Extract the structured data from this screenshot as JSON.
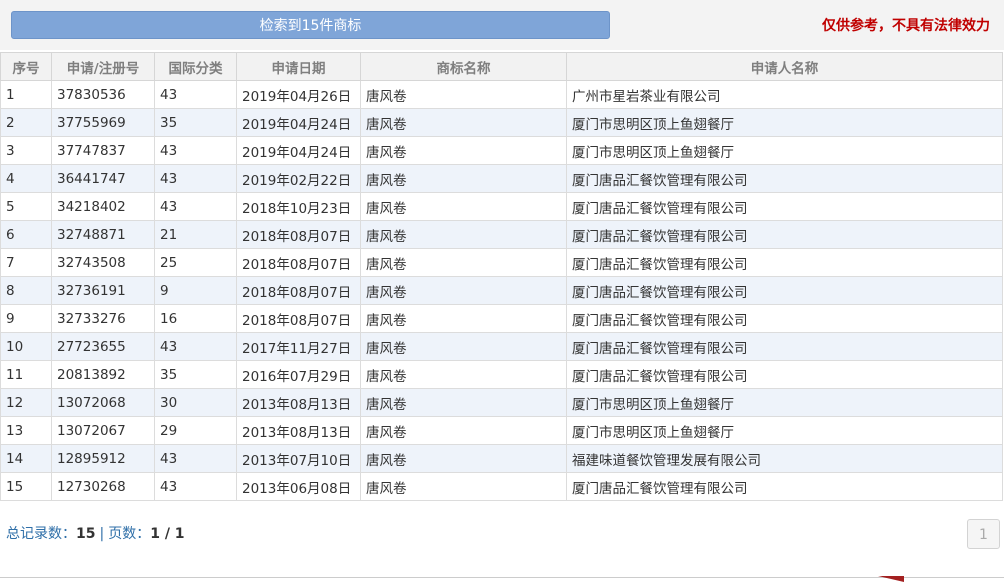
{
  "header": {
    "result_text": "检索到15件商标",
    "disclaimer": "仅供参考，不具有法律效力"
  },
  "table": {
    "columns": [
      "序号",
      "申请/注册号",
      "国际分类",
      "申请日期",
      "商标名称",
      "申请人名称"
    ],
    "rows": [
      [
        "1",
        "37830536",
        "43",
        "2019年04月26日",
        "唐风卷",
        "广州市星岩茶业有限公司"
      ],
      [
        "2",
        "37755969",
        "35",
        "2019年04月24日",
        "唐风卷",
        "厦门市思明区顶上鱼翅餐厅"
      ],
      [
        "3",
        "37747837",
        "43",
        "2019年04月24日",
        "唐风卷",
        "厦门市思明区顶上鱼翅餐厅"
      ],
      [
        "4",
        "36441747",
        "43",
        "2019年02月22日",
        "唐风卷",
        "厦门唐品汇餐饮管理有限公司"
      ],
      [
        "5",
        "34218402",
        "43",
        "2018年10月23日",
        "唐风卷",
        "厦门唐品汇餐饮管理有限公司"
      ],
      [
        "6",
        "32748871",
        "21",
        "2018年08月07日",
        "唐风卷",
        "厦门唐品汇餐饮管理有限公司"
      ],
      [
        "7",
        "32743508",
        "25",
        "2018年08月07日",
        "唐风卷",
        "厦门唐品汇餐饮管理有限公司"
      ],
      [
        "8",
        "32736191",
        "9",
        "2018年08月07日",
        "唐风卷",
        "厦门唐品汇餐饮管理有限公司"
      ],
      [
        "9",
        "32733276",
        "16",
        "2018年08月07日",
        "唐风卷",
        "厦门唐品汇餐饮管理有限公司"
      ],
      [
        "10",
        "27723655",
        "43",
        "2017年11月27日",
        "唐风卷",
        "厦门唐品汇餐饮管理有限公司"
      ],
      [
        "11",
        "20813892",
        "35",
        "2016年07月29日",
        "唐风卷",
        "厦门唐品汇餐饮管理有限公司"
      ],
      [
        "12",
        "13072068",
        "30",
        "2013年08月13日",
        "唐风卷",
        "厦门市思明区顶上鱼翅餐厅"
      ],
      [
        "13",
        "13072067",
        "29",
        "2013年08月13日",
        "唐风卷",
        "厦门市思明区顶上鱼翅餐厅"
      ],
      [
        "14",
        "12895912",
        "43",
        "2013年07月10日",
        "唐风卷",
        "福建味道餐饮管理发展有限公司"
      ],
      [
        "15",
        "12730268",
        "43",
        "2013年06月08日",
        "唐风卷",
        "厦门唐品汇餐饮管理有限公司"
      ]
    ]
  },
  "footer": {
    "total_label": "总记录数：",
    "total_value": "15",
    "separator": "|",
    "page_label": "页数：",
    "page_value": "1 / 1",
    "page_button": "1"
  }
}
